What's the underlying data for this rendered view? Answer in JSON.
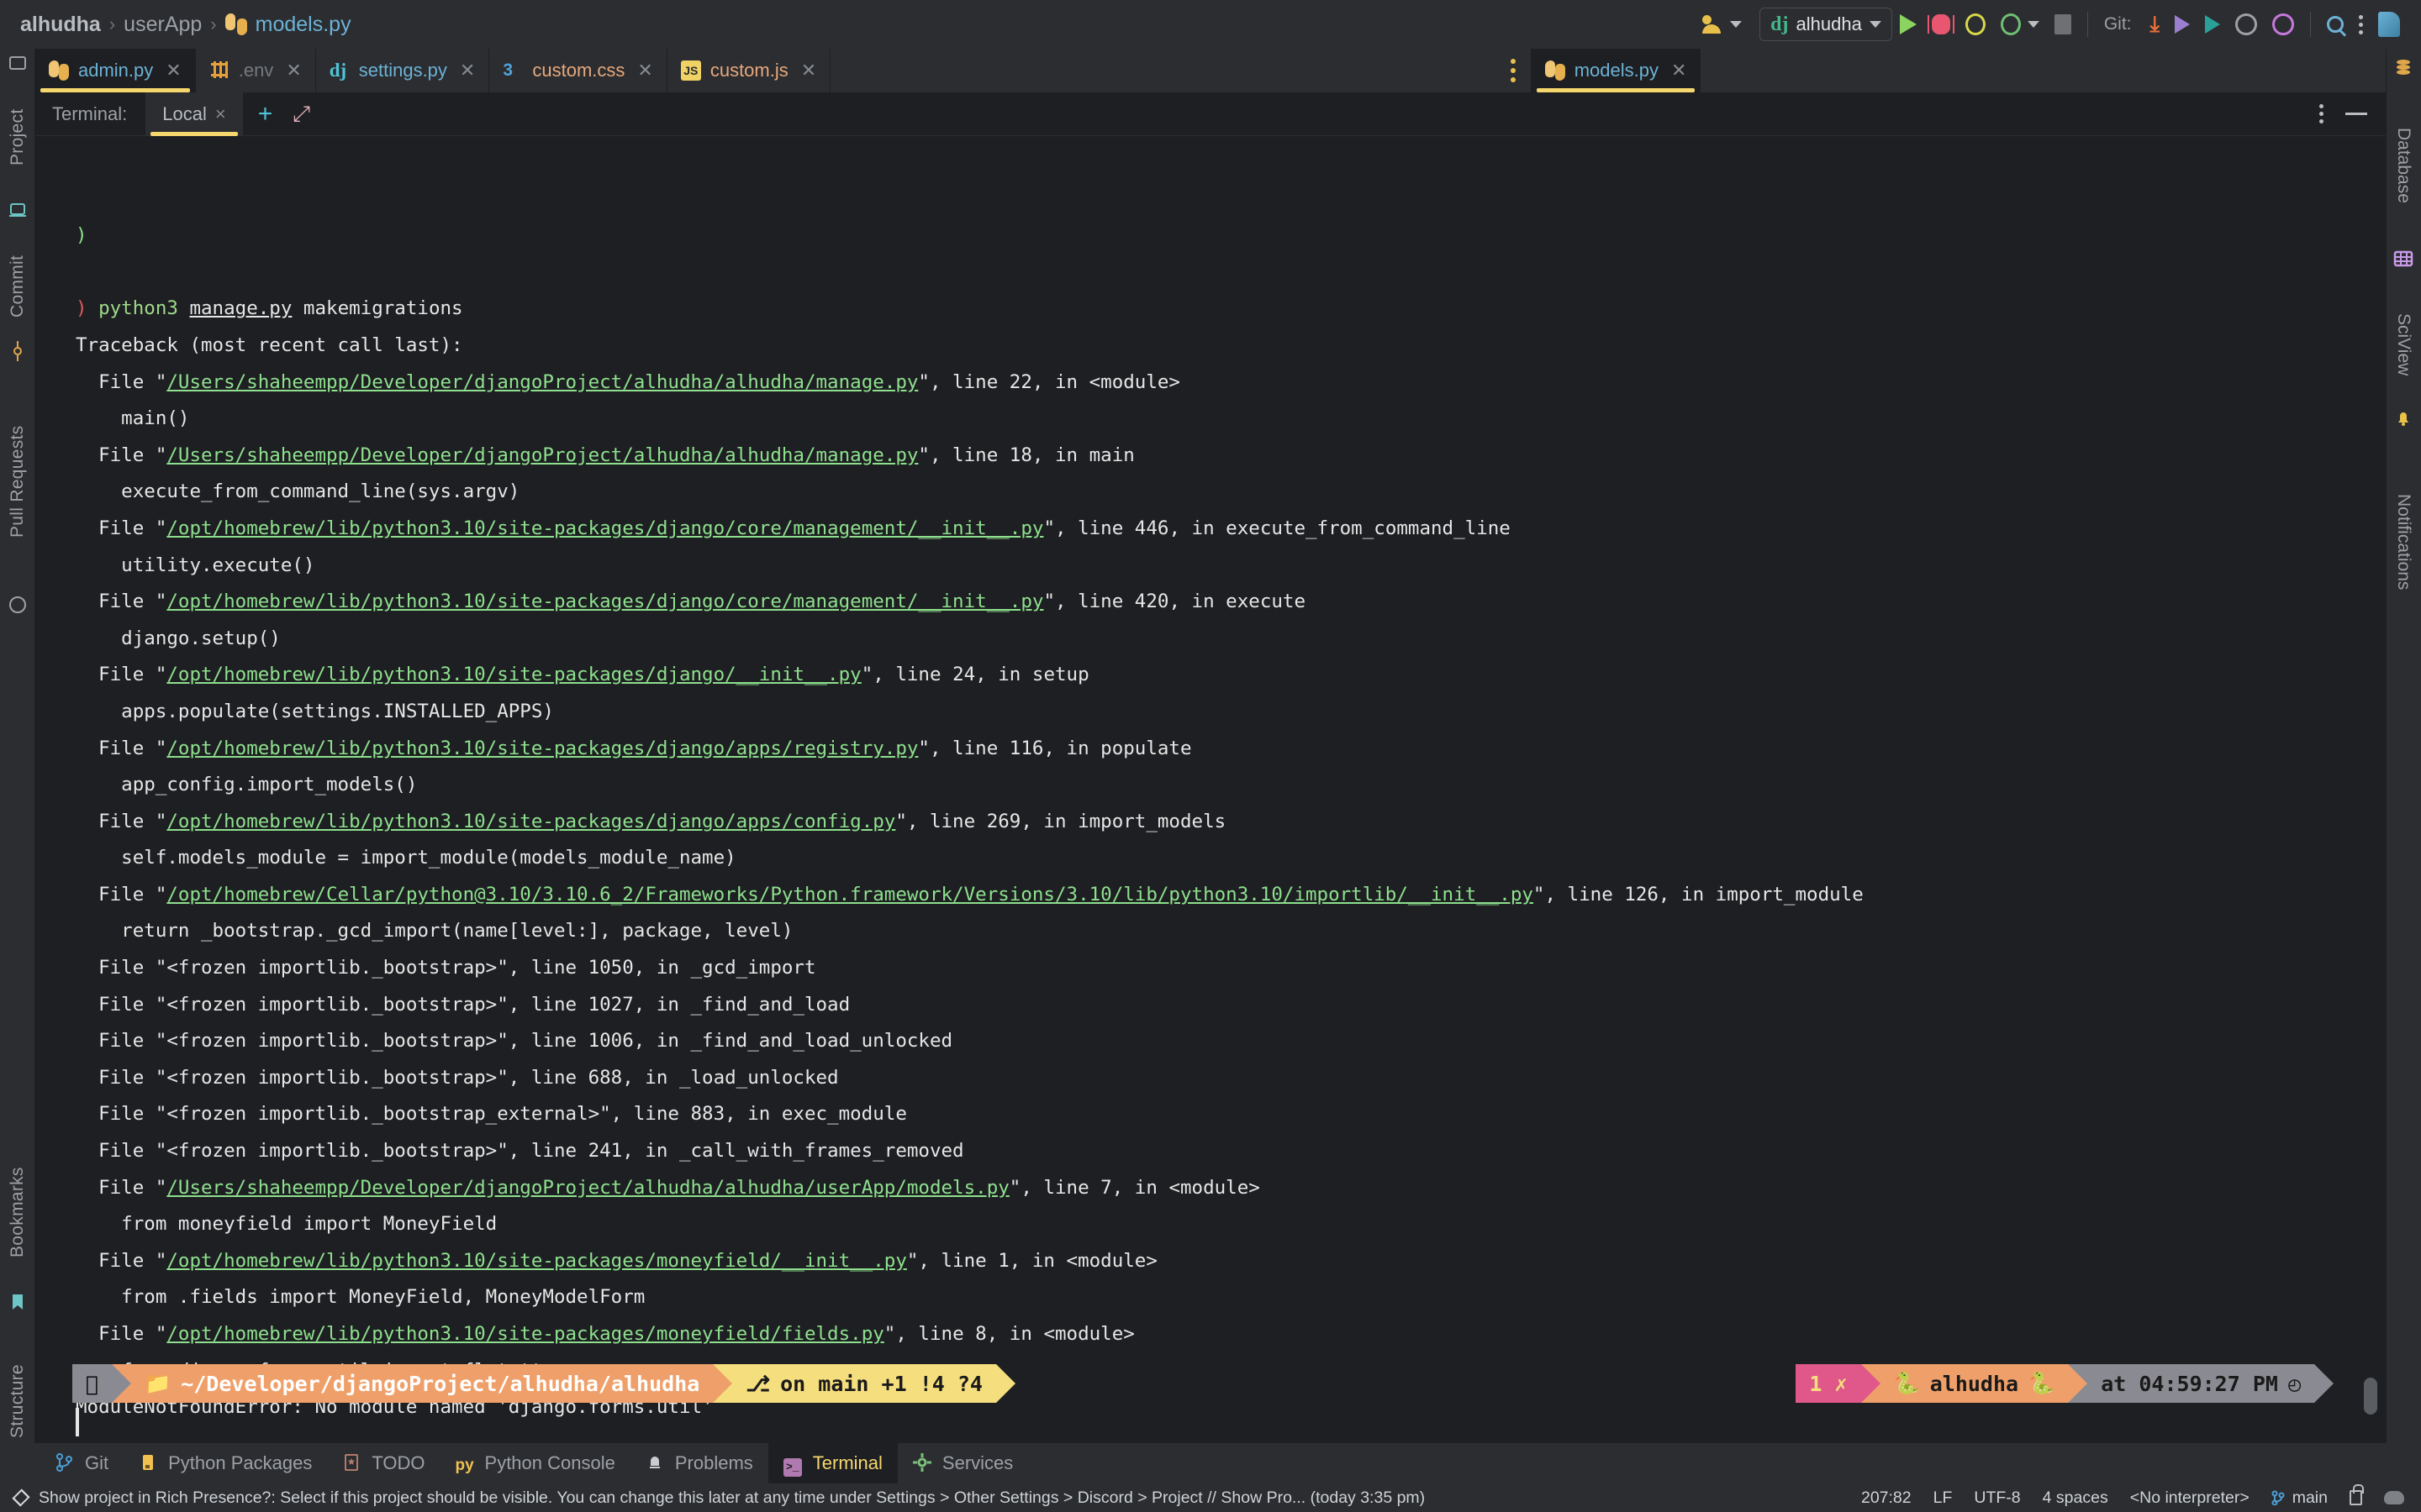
{
  "window": {
    "breadcrumb": {
      "project": "alhudha",
      "folder": "userApp",
      "file": "models.py",
      "sep": "›"
    }
  },
  "toolbar": {
    "users_icon": "users-icon",
    "run_config": {
      "label": "alhudha",
      "icon": "django-icon"
    },
    "run_label": "run-icon",
    "debug_label": "debug-icon",
    "coverage_label": "coverage-icon",
    "profile_label": "profile-icon",
    "stop_label": "stop-icon",
    "git_label": "Git:",
    "update_icon": "update-project-icon",
    "push_icon": "push-icon",
    "merge_icon": "merge-icon",
    "history_icon": "history-icon",
    "rollback_icon": "rollback-icon",
    "search_icon": "search-everywhere-icon",
    "more_icon": "more-options-icon",
    "jetbrains_icon": "jetbrains-ai-icon"
  },
  "left_rail": [
    {
      "label": "Project",
      "icon": "project-icon"
    },
    {
      "label": "Commit",
      "icon": "commit-icon"
    },
    {
      "label": "Pull Requests",
      "icon": "pull-requests-icon"
    },
    {
      "label": "Bookmarks",
      "icon": "bookmarks-icon"
    },
    {
      "label": "Structure",
      "icon": "structure-icon"
    }
  ],
  "right_rail": [
    {
      "label": "Database",
      "icon": "database-icon"
    },
    {
      "label": "SciView",
      "icon": "sciview-icon"
    },
    {
      "label": "Notifications",
      "icon": "notifications-icon"
    }
  ],
  "editor_tabs": [
    {
      "label": "admin.py",
      "icon": "python-file-icon",
      "active": true,
      "style": "py"
    },
    {
      "label": ".env",
      "icon": "env-file-icon",
      "active": false,
      "style": "muted"
    },
    {
      "label": "settings.py",
      "icon": "django-file-icon",
      "active": false,
      "style": "py"
    },
    {
      "label": "custom.css",
      "icon": "css-file-icon",
      "active": false,
      "style": "css"
    },
    {
      "label": "custom.js",
      "icon": "js-file-icon",
      "active": false,
      "style": "js"
    }
  ],
  "editor_tabs_right": [
    {
      "label": "models.py",
      "icon": "python-file-icon",
      "active": true,
      "style": "py"
    }
  ],
  "terminal_header": {
    "label": "Terminal:",
    "tab": "Local",
    "close": "×",
    "add": "+",
    "expand": "expand-icon",
    "options": "more-options-icon",
    "minimize": "minimize-icon"
  },
  "terminal": {
    "lines": [
      {
        "segments": [
          {
            "t": ")",
            "c": "green"
          }
        ]
      },
      {
        "segments": []
      },
      {
        "segments": [
          {
            "t": ")",
            "c": "red"
          },
          {
            "t": " "
          },
          {
            "t": "python3",
            "c": "lgreen"
          },
          {
            "t": " "
          },
          {
            "t": "manage.py",
            "c": "white-under"
          },
          {
            "t": " makemigrations",
            "c": "white"
          }
        ]
      },
      {
        "segments": [
          {
            "t": "Traceback (most recent call last):",
            "c": "white"
          }
        ]
      },
      {
        "segments": [
          {
            "t": "  File \"",
            "c": "white"
          },
          {
            "t": "/Users/shaheempp/Developer/djangoProject/alhudha/alhudha/manage.py",
            "c": "link"
          },
          {
            "t": "\", line 22, in <module>",
            "c": "white"
          }
        ]
      },
      {
        "segments": [
          {
            "t": "    main()",
            "c": "white"
          }
        ]
      },
      {
        "segments": [
          {
            "t": "  File \"",
            "c": "white"
          },
          {
            "t": "/Users/shaheempp/Developer/djangoProject/alhudha/alhudha/manage.py",
            "c": "link"
          },
          {
            "t": "\", line 18, in main",
            "c": "white"
          }
        ]
      },
      {
        "segments": [
          {
            "t": "    execute_from_command_line(sys.argv)",
            "c": "white"
          }
        ]
      },
      {
        "segments": [
          {
            "t": "  File \"",
            "c": "white"
          },
          {
            "t": "/opt/homebrew/lib/python3.10/site-packages/django/core/management/__init__.py",
            "c": "link"
          },
          {
            "t": "\", line 446, in execute_from_command_line",
            "c": "white"
          }
        ]
      },
      {
        "segments": [
          {
            "t": "    utility.execute()",
            "c": "white"
          }
        ]
      },
      {
        "segments": [
          {
            "t": "  File \"",
            "c": "white"
          },
          {
            "t": "/opt/homebrew/lib/python3.10/site-packages/django/core/management/__init__.py",
            "c": "link"
          },
          {
            "t": "\", line 420, in execute",
            "c": "white"
          }
        ]
      },
      {
        "segments": [
          {
            "t": "    django.setup()",
            "c": "white"
          }
        ]
      },
      {
        "segments": [
          {
            "t": "  File \"",
            "c": "white"
          },
          {
            "t": "/opt/homebrew/lib/python3.10/site-packages/django/__init__.py",
            "c": "link"
          },
          {
            "t": "\", line 24, in setup",
            "c": "white"
          }
        ]
      },
      {
        "segments": [
          {
            "t": "    apps.populate(settings.INSTALLED_APPS)",
            "c": "white"
          }
        ]
      },
      {
        "segments": [
          {
            "t": "  File \"",
            "c": "white"
          },
          {
            "t": "/opt/homebrew/lib/python3.10/site-packages/django/apps/registry.py",
            "c": "link"
          },
          {
            "t": "\", line 116, in populate",
            "c": "white"
          }
        ]
      },
      {
        "segments": [
          {
            "t": "    app_config.import_models()",
            "c": "white"
          }
        ]
      },
      {
        "segments": [
          {
            "t": "  File \"",
            "c": "white"
          },
          {
            "t": "/opt/homebrew/lib/python3.10/site-packages/django/apps/config.py",
            "c": "link"
          },
          {
            "t": "\", line 269, in import_models",
            "c": "white"
          }
        ]
      },
      {
        "segments": [
          {
            "t": "    self.models_module = import_module(models_module_name)",
            "c": "white"
          }
        ]
      },
      {
        "segments": [
          {
            "t": "  File \"",
            "c": "white"
          },
          {
            "t": "/opt/homebrew/Cellar/python@3.10/3.10.6_2/Frameworks/Python.framework/Versions/3.10/lib/python3.10/importlib/__init__.py",
            "c": "link"
          },
          {
            "t": "\", line 126, in import_module",
            "c": "white"
          }
        ]
      },
      {
        "segments": [
          {
            "t": "    return _bootstrap._gcd_import(name[level:], package, level)",
            "c": "white"
          }
        ]
      },
      {
        "segments": [
          {
            "t": "  File \"<frozen importlib._bootstrap>\", line 1050, in _gcd_import",
            "c": "white"
          }
        ]
      },
      {
        "segments": [
          {
            "t": "  File \"<frozen importlib._bootstrap>\", line 1027, in _find_and_load",
            "c": "white"
          }
        ]
      },
      {
        "segments": [
          {
            "t": "  File \"<frozen importlib._bootstrap>\", line 1006, in _find_and_load_unlocked",
            "c": "white"
          }
        ]
      },
      {
        "segments": [
          {
            "t": "  File \"<frozen importlib._bootstrap>\", line 688, in _load_unlocked",
            "c": "white"
          }
        ]
      },
      {
        "segments": [
          {
            "t": "  File \"<frozen importlib._bootstrap_external>\", line 883, in exec_module",
            "c": "white"
          }
        ]
      },
      {
        "segments": [
          {
            "t": "  File \"<frozen importlib._bootstrap>\", line 241, in _call_with_frames_removed",
            "c": "white"
          }
        ]
      },
      {
        "segments": [
          {
            "t": "  File \"",
            "c": "white"
          },
          {
            "t": "/Users/shaheempp/Developer/djangoProject/alhudha/alhudha/userApp/models.py",
            "c": "link"
          },
          {
            "t": "\", line 7, in <module>",
            "c": "white"
          }
        ]
      },
      {
        "segments": [
          {
            "t": "    from moneyfield import MoneyField",
            "c": "white"
          }
        ]
      },
      {
        "segments": [
          {
            "t": "  File \"",
            "c": "white"
          },
          {
            "t": "/opt/homebrew/lib/python3.10/site-packages/moneyfield/__init__.py",
            "c": "link"
          },
          {
            "t": "\", line 1, in <module>",
            "c": "white"
          }
        ]
      },
      {
        "segments": [
          {
            "t": "    from .fields import MoneyField, MoneyModelForm",
            "c": "white"
          }
        ]
      },
      {
        "segments": [
          {
            "t": "  File \"",
            "c": "white"
          },
          {
            "t": "/opt/homebrew/lib/python3.10/site-packages/moneyfield/fields.py",
            "c": "link"
          },
          {
            "t": "\", line 8, in <module>",
            "c": "white"
          }
        ]
      },
      {
        "segments": [
          {
            "t": "    from django.forms.util import flatatt",
            "c": "white"
          }
        ]
      },
      {
        "segments": [
          {
            "t": "ModuleNotFoundError: No module named 'django.forms.util'",
            "c": "white"
          }
        ]
      }
    ]
  },
  "prompt": {
    "left_segments": [
      {
        "text": "",
        "icon": "apple-icon",
        "bg": "#8a8a92",
        "fg": "#000000"
      },
      {
        "text": "~/Developer/djangoProject/alhudha/alhudha",
        "icon": "folder-icon",
        "bg": "#efa06a",
        "fg": "#ffffff",
        "bold_tail": "alhudha"
      },
      {
        "text": "on  main +1 !4 ?4",
        "icon": "github-branch-icon",
        "bg": "#f5de7e",
        "fg": "#1a1a1a"
      }
    ],
    "right_segments": [
      {
        "text": "1 ✗",
        "bg": "#e0588a",
        "fg": "#f5de7e"
      },
      {
        "text": "alhudha",
        "icon": "python-icon",
        "bg": "#efa06a",
        "fg": "#1a1a1a"
      },
      {
        "text": "at 04:59:27 PM",
        "icon": "clock-icon",
        "bg": "#8a8a92",
        "fg": "#1a1a1a"
      }
    ]
  },
  "bottom_tools": [
    {
      "label": "Git",
      "icon": "git-icon",
      "active": false
    },
    {
      "label": "Python Packages",
      "icon": "python-packages-icon",
      "active": false
    },
    {
      "label": "TODO",
      "icon": "todo-icon",
      "active": false
    },
    {
      "label": "Python Console",
      "icon": "python-console-icon",
      "active": false
    },
    {
      "label": "Problems",
      "icon": "problems-icon",
      "active": false
    },
    {
      "label": "Terminal",
      "icon": "terminal-icon",
      "active": true
    },
    {
      "label": "Services",
      "icon": "services-icon",
      "active": false
    }
  ],
  "status_bar": {
    "message": "Show project in Rich Presence?: Select if this project should be visible. You can change this later at any time under Settings > Other Settings > Discord > Project // Show Pro... (today 3:35 pm)",
    "caret": "207:82",
    "line_sep": "LF",
    "encoding": "UTF-8",
    "indent": "4 spaces",
    "interpreter": "<No interpreter>",
    "branch": "main",
    "lock_icon": "lock-icon",
    "cloud_icon": "cloud-settings-icon"
  },
  "colors": {
    "bg": "#1e1f22",
    "panel": "#2b2d30",
    "accent": "#f5d76e",
    "link_green": "#8ee08e",
    "tab_blue": "#6cb2d6"
  }
}
